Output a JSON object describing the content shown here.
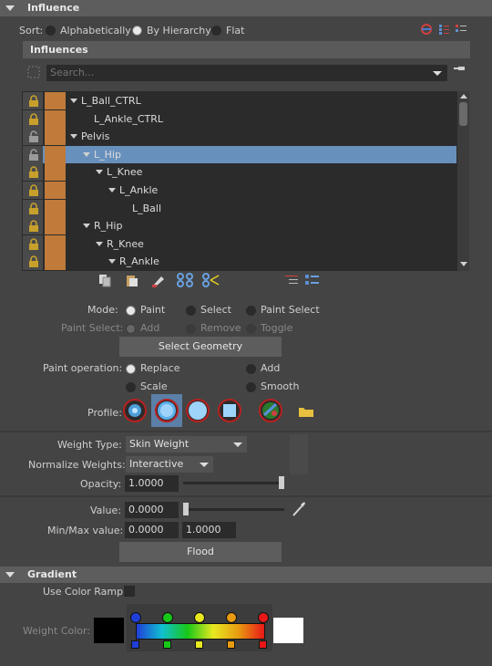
{
  "influence_header": {
    "title": "Influence"
  },
  "sort": {
    "label": "Sort:",
    "options": [
      "Alphabetically",
      "By Hierarchy",
      "Flat"
    ],
    "selected": "By Hierarchy"
  },
  "influences": {
    "title": "Influences",
    "search_placeholder": "Search...",
    "rows": [
      {
        "name": "L_Ball_CTRL",
        "locked": true,
        "selected": false
      },
      {
        "name": "L_Ankle_CTRL",
        "locked": true,
        "selected": false
      },
      {
        "name": "Pelvis",
        "locked": false,
        "selected": false
      },
      {
        "name": "L_Hip",
        "locked": false,
        "selected": true
      },
      {
        "name": "L_Knee",
        "locked": true,
        "selected": false
      },
      {
        "name": "L_Ankle",
        "locked": true,
        "selected": false
      },
      {
        "name": "L_Ball",
        "locked": true,
        "selected": false
      },
      {
        "name": "R_Hip",
        "locked": true,
        "selected": false
      },
      {
        "name": "R_Knee",
        "locked": true,
        "selected": false
      },
      {
        "name": "R_Ankle",
        "locked": true,
        "selected": false
      }
    ]
  },
  "mode": {
    "label": "Mode:",
    "options": [
      "Paint",
      "Select",
      "Paint Select"
    ],
    "selected": "Paint"
  },
  "paint_select": {
    "label": "Paint Select:",
    "options": [
      "Add",
      "Remove",
      "Toggle"
    ],
    "selected": "Add",
    "enabled": false
  },
  "select_geometry": {
    "label": "Select Geometry"
  },
  "paint_operation": {
    "label": "Paint operation:",
    "options": [
      "Replace",
      "Add",
      "Scale",
      "Smooth"
    ],
    "selected": "Replace"
  },
  "profile": {
    "label": "Profile:",
    "selected_index": 1
  },
  "weight_type": {
    "label": "Weight Type:",
    "value": "Skin Weight"
  },
  "normalize_weights": {
    "label": "Normalize Weights:",
    "value": "Interactive"
  },
  "opacity": {
    "label": "Opacity:",
    "value": "1.0000",
    "fraction": 1.0
  },
  "value": {
    "label": "Value:",
    "value": "0.0000",
    "fraction": 0.0
  },
  "minmax": {
    "label": "Min/Max value:",
    "min": "0.0000",
    "max": "1.0000"
  },
  "flood": {
    "label": "Flood"
  },
  "gradient_header": {
    "title": "Gradient"
  },
  "use_color_ramp": {
    "label": "Use Color Ramp",
    "checked": false
  },
  "weight_color": {
    "label": "Weight Color:",
    "left_swatch": "#000000",
    "right_swatch": "#ffffff",
    "ramp_colors": [
      "#1f3fd8",
      "#10c0d0",
      "#18c818",
      "#e8e820",
      "#e89a10",
      "#e81818"
    ],
    "marker_colors": [
      "#1f3fd8",
      "#18c818",
      "#e8e820",
      "#e89a10",
      "#e81818"
    ]
  },
  "colors": {
    "lock_color": "#c7a02c",
    "joint_color": "#c07a3a",
    "selection": "#6790bd"
  }
}
